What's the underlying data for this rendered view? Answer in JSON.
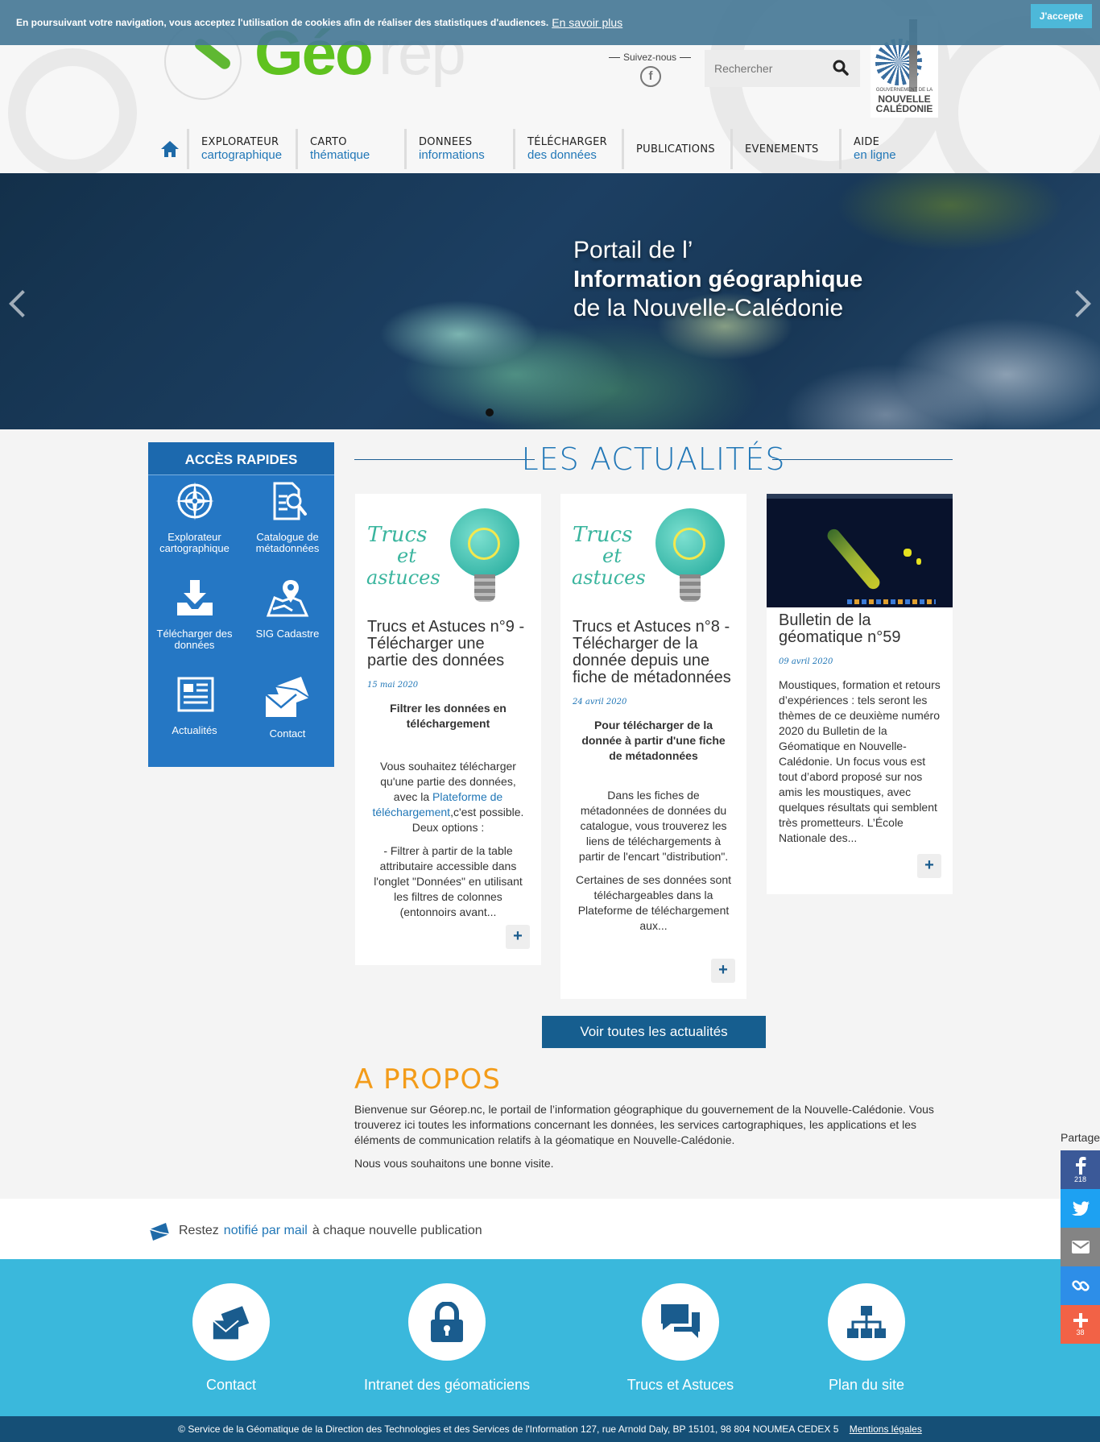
{
  "cookie": {
    "message": "En poursuivant votre navigation, vous acceptez l'utilisation de cookies afin de réaliser des statistiques d'audiences.",
    "more_link": "En savoir plus",
    "accept_label": "J'accepte"
  },
  "header": {
    "logo_part1": "Géo",
    "logo_part2": "rep",
    "follow_label": "Suivez-nous",
    "search_placeholder": "Rechercher",
    "gov_logo_line1": "GOUVERNEMENT DE LA",
    "gov_logo_line2": "NOUVELLE",
    "gov_logo_line3": "CALÉDONIE"
  },
  "nav": [
    {
      "l1": "EXPLORATEUR",
      "l2": "cartographique"
    },
    {
      "l1": "CARTO",
      "l2": "thématique"
    },
    {
      "l1": "DONNEES",
      "l2": "informations"
    },
    {
      "l1": "TÉLÉCHARGER",
      "l2": "des données"
    },
    {
      "l1": "PUBLICATIONS",
      "l2": ""
    },
    {
      "l1": "EVENEMENTS",
      "l2": ""
    },
    {
      "l1": "AIDE",
      "l2": "en ligne"
    }
  ],
  "hero": {
    "line1": "Portail de l’",
    "line2": "Information géographique",
    "line3": "de la Nouvelle-Calédonie"
  },
  "quick_access": {
    "title": "ACCÈS RAPIDES",
    "items": [
      {
        "label": "Explorateur cartographique",
        "icon": "compass-icon"
      },
      {
        "label": "Catalogue de métadonnées",
        "icon": "document-search-icon"
      },
      {
        "label": "Télécharger des données",
        "icon": "download-icon"
      },
      {
        "label": "SIG Cadastre",
        "icon": "map-pin-icon"
      },
      {
        "label": "Actualités",
        "icon": "newspaper-icon"
      },
      {
        "label": "Contact",
        "icon": "envelope-icon"
      }
    ]
  },
  "news": {
    "title": "LES ACTUALITÉS",
    "cards": [
      {
        "thumb_t1": "Trucs",
        "thumb_t2": "et",
        "thumb_t3": "astuces",
        "title": "Trucs et Astuces n°9 - Télécharger une partie des données",
        "date": "15 mai 2020",
        "subtitle": "Filtrer les données en téléchargement",
        "body1_pre": "Vous souhaitez télécharger qu'une partie des données, avec la ",
        "body1_link": "Plateforme de téléchargement",
        "body1_post": ",c'est possible. Deux options :",
        "body2": "- Filtrer à partir de la table attributaire accessible dans l'onglet \"Données\" en utilisant les filtres de colonnes (entonnoirs avant..."
      },
      {
        "thumb_t1": "Trucs",
        "thumb_t2": "et",
        "thumb_t3": "astuces",
        "title": "Trucs et Astuces n°8 - Télécharger de la donnée depuis une fiche de métadonnées",
        "date": "24 avril 2020",
        "subtitle": "Pour télécharger de la donnée à partir d'une fiche de métadonnées",
        "body1": "Dans les fiches de métadonnées de données du catalogue, vous trouverez les liens de téléchargements à partir de l'encart \"distribution\".",
        "body2": "Certaines de ses données sont téléchargeables dans la Plateforme de téléchargement aux..."
      },
      {
        "title": "Bulletin de la géomatique n°59",
        "date": "09 avril 2020",
        "body": "Moustiques, formation et retours d’expériences : tels seront les thèmes de ce deuxième numéro 2020 du Bulletin de la Géomatique en Nouvelle-Calédonie. Un focus vous est tout d’abord proposé sur nos amis les moustiques, avec quelques résultats qui semblent très prometteurs. L’École Nationale des..."
      }
    ],
    "more_label": "+",
    "all_button": "Voir toutes les actualités"
  },
  "about": {
    "title": "A PROPOS",
    "p1": "Bienvenue sur Géorep.nc, le portail de l’information géographique du gouvernement de la Nouvelle-Calédonie. Vous trouverez ici toutes les informations concernant les données, les services cartographiques, les applications et les éléments de communication relatifs à la géomatique en Nouvelle-Calédonie.",
    "p2": "Nous vous souhaitons une bonne visite."
  },
  "notify": {
    "pre": "Restez",
    "link": "notifié par mail",
    "post": "à chaque nouvelle publication"
  },
  "footer_links": [
    {
      "label": "Contact",
      "icon": "envelope-icon"
    },
    {
      "label": "Intranet des géomaticiens",
      "icon": "lock-icon"
    },
    {
      "label": "Trucs et Astuces",
      "icon": "chat-icon"
    },
    {
      "label": "Plan du site",
      "icon": "sitemap-icon"
    }
  ],
  "footer": {
    "copyright": "©  Service de la Géomatique de la Direction des Technologies et des Services de l'Information   127, rue Arnold Daly, BP 15101, 98 804 NOUMEA CEDEX 5",
    "legal_link": "Mentions légales"
  },
  "share": {
    "label": "Partage",
    "facebook_count": "218",
    "more_count": "38",
    "colors": {
      "facebook": "#3b5998",
      "twitter": "#1da1f2",
      "email": "#848484",
      "link": "#2d8ee8",
      "more": "#f26246"
    }
  }
}
